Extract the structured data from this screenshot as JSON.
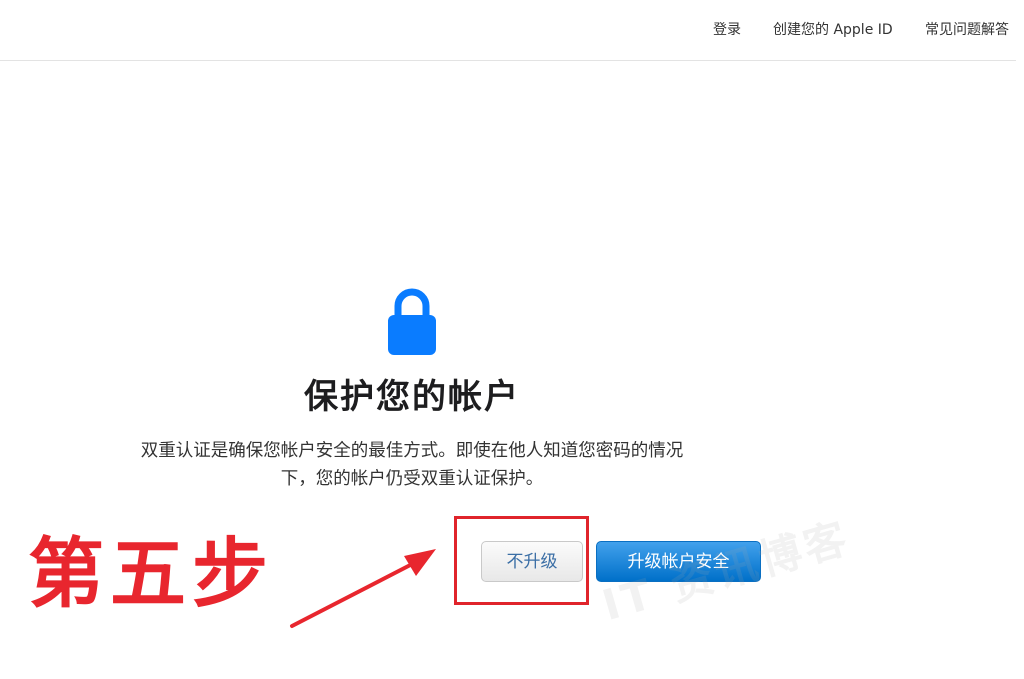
{
  "nav": {
    "sign_in": "登录",
    "create_apple_id": "创建您的 Apple ID",
    "faq": "常见问题解答"
  },
  "main": {
    "icon": "lock-icon",
    "title": "保护您的帐户",
    "description_line1": "双重认证是确保您帐户安全的最佳方式。即使在他人知道您密码的情况",
    "description_line2": "下，您的帐户仍受双重认证保护。",
    "not_upgrade_label": "不升级",
    "upgrade_label": "升级帐户安全"
  },
  "annotation": {
    "step_label": "第五步",
    "color": "#e8262e"
  },
  "watermark": {
    "text": "IT 资讯博客"
  },
  "colors": {
    "primary_button": "#0070c9",
    "lock_icon": "#0a7cff"
  }
}
